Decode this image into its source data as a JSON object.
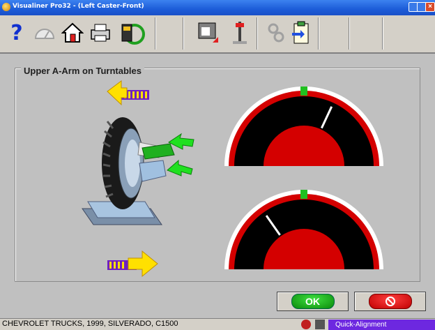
{
  "window": {
    "title": "Visualiner Pro32 - (Left Caster-Front)"
  },
  "toolbar": {
    "help_label": "?",
    "items": [
      {
        "icon": "help-icon"
      },
      {
        "icon": "speedometer-icon"
      },
      {
        "icon": "home-icon"
      },
      {
        "icon": "printer-icon"
      },
      {
        "icon": "wheel-sensor-icon"
      },
      {
        "icon": "vehicle-specs-icon"
      },
      {
        "icon": "lift-icon"
      },
      {
        "icon": "tools-icon"
      },
      {
        "icon": "clipboard-icon"
      }
    ]
  },
  "panel": {
    "title": "Upper A-Arm on Turntables"
  },
  "gauges": [
    {
      "name": "upper-gauge",
      "needle_angle_deg": 25
    },
    {
      "name": "lower-gauge",
      "needle_angle_deg": -35
    }
  ],
  "buttons": {
    "ok_label": "OK"
  },
  "status": {
    "vehicle": "CHEVROLET TRUCKS, 1999, SILVERADO, C1500",
    "mode": "Quick-Alignment"
  },
  "colors": {
    "gauge_red": "#d40000",
    "gauge_black": "#000000",
    "target_green": "#20c020",
    "arrow_yellow": "#ffe000",
    "arrow_purple": "#7020c0",
    "status_purple": "#6d28e0"
  }
}
